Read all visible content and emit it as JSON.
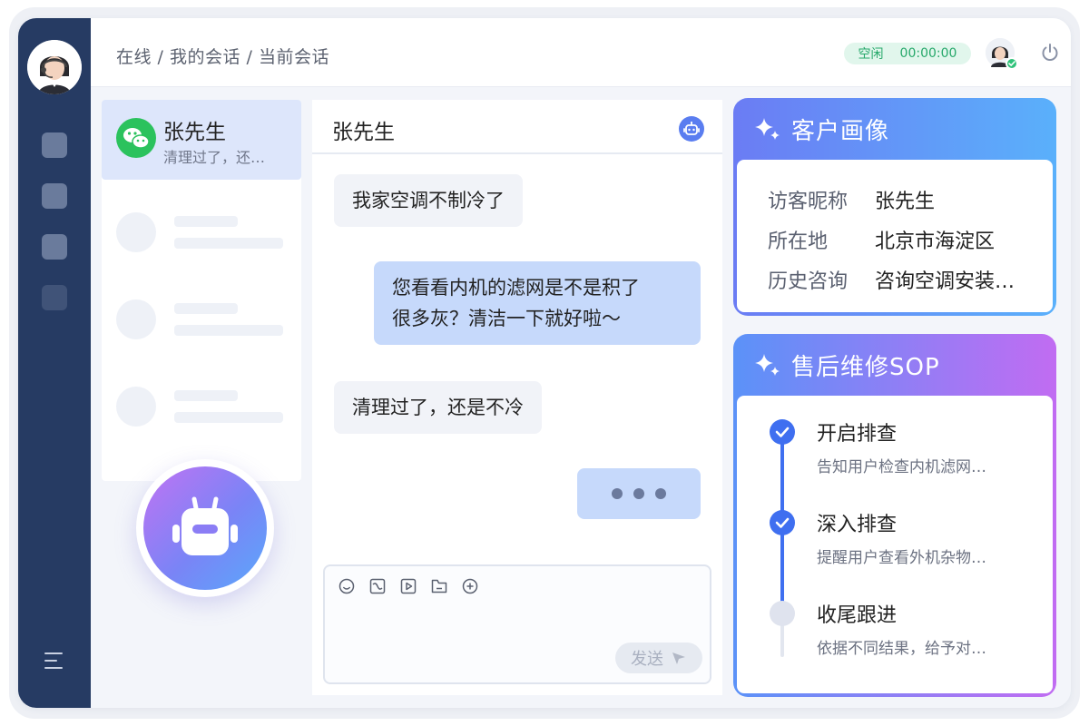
{
  "header": {
    "breadcrumb": "在线 / 我的会话 / 当前会话",
    "status_label": "空闲",
    "status_timer": "00:00:00"
  },
  "conversations": {
    "active": {
      "name": "张先生",
      "preview": "清理过了，还…"
    }
  },
  "chat": {
    "title": "张先生",
    "messages": [
      {
        "side": "in",
        "text": "我家空调不制冷了"
      },
      {
        "side": "out",
        "lines": [
          "您看看内机的滤网是不是积了",
          "很多灰？清洁一下就好啦～"
        ]
      },
      {
        "side": "in",
        "text": "清理过了，还是不冷"
      }
    ],
    "send_label": "发送"
  },
  "profile": {
    "title": "客户画像",
    "rows": [
      {
        "label": "访客昵称",
        "value": "张先生"
      },
      {
        "label": "所在地",
        "value": "北京市海淀区"
      },
      {
        "label": "历史咨询",
        "value": "咨询空调安装…"
      }
    ]
  },
  "sop": {
    "title": "售后维修SOP",
    "steps": [
      {
        "title": "开启排查",
        "desc": "告知用户检查内机滤网…",
        "done": true
      },
      {
        "title": "深入排查",
        "desc": "提醒用户查看外机杂物…",
        "done": true
      },
      {
        "title": "收尾跟进",
        "desc": "依据不同结果，给予对…",
        "done": false
      }
    ]
  },
  "colors": {
    "sidebar": "#263b63",
    "accent_blue": "#3f6ff0",
    "status_green": "#26a86a",
    "bubble_out": "#c6d9fb",
    "bubble_in": "#f1f3f8"
  }
}
